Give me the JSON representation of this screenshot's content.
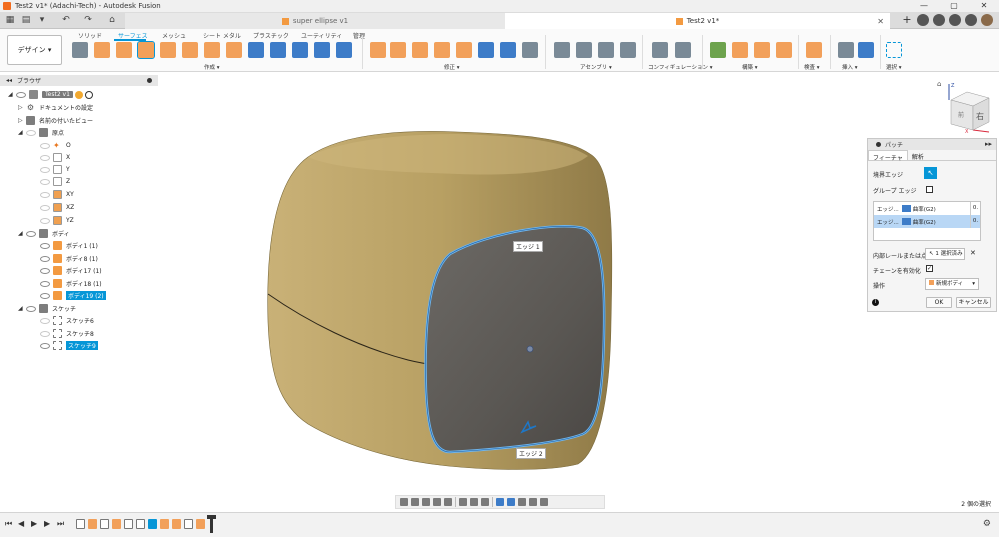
{
  "window": {
    "title": "Test2 v1* (Adachi-Tech) - Autodesk Fusion",
    "controls": [
      "—",
      "▢",
      "✕"
    ]
  },
  "tabs": {
    "inactive_label": "super ellipse v1",
    "active_label": "Test2 v1*",
    "close_glyph": "✕",
    "new_tab_glyph": "+"
  },
  "toolbar": {
    "workspace_button": "デザイン ▾",
    "ribbon_tabs": [
      "ソリッド",
      "サーフェス",
      "メッシュ",
      "シート メタル",
      "プラスチック",
      "ユーティリティ",
      "管理"
    ],
    "active_tab": "サーフェス",
    "groups": [
      "作成 ▾",
      "修正 ▾",
      "アセンブリ ▾",
      "コンフィギュレーション ▾",
      "構築 ▾",
      "検査 ▾",
      "挿入 ▾",
      "選択 ▾"
    ]
  },
  "browser": {
    "header": "ブラウザ",
    "root_label": "Test2 v1",
    "document_settings": "ドキュメントの設定",
    "named_views": "名前の付いたビュー",
    "origin": "原点",
    "origin_items": [
      "O",
      "X",
      "Y",
      "Z",
      "XY",
      "XZ",
      "YZ"
    ],
    "bodies": "ボディ",
    "body_items": [
      "ボディ1 (1)",
      "ボディ8 (1)",
      "ボディ17 (1)",
      "ボディ18 (1)",
      "ボディ19 (2)"
    ],
    "sketches": "スケッチ",
    "sketch_items": [
      "スケッチ6",
      "スケッチ8",
      "スケッチ9"
    ]
  },
  "viewport": {
    "edge_label_1": "エッジ 1",
    "edge_label_2": "エッジ 2",
    "viewcube_face": "右",
    "viewcube_side": "前",
    "axis_z": "Z",
    "axis_x": "X",
    "body_color": "#b8a063",
    "patch_color": "#5e5b57",
    "edge_highlight": "#6fb4ea"
  },
  "dialog": {
    "title": "パッチ",
    "tabs": [
      "フィーチャ",
      "解析"
    ],
    "boundary_edge_label": "境界エッジ",
    "group_edge_label": "グループ エッジ",
    "edges": [
      {
        "name": "エッジ...",
        "continuity": "曲率(G2)",
        "value": "0."
      },
      {
        "name": "エッジ...",
        "continuity": "曲率(G2)",
        "value": "0."
      }
    ],
    "interior_label": "内部レールまたは点",
    "interior_value": "1 選択済み",
    "chain_label": "チェーンを有効化",
    "operation_label": "操作",
    "operation_value": "新規ボディ",
    "ok": "OK",
    "cancel": "キャンセル"
  },
  "status": {
    "selection_count": "2 個の選択"
  },
  "colors": {
    "accent": "#0696d7",
    "tool_orange": "#f2a05a"
  }
}
